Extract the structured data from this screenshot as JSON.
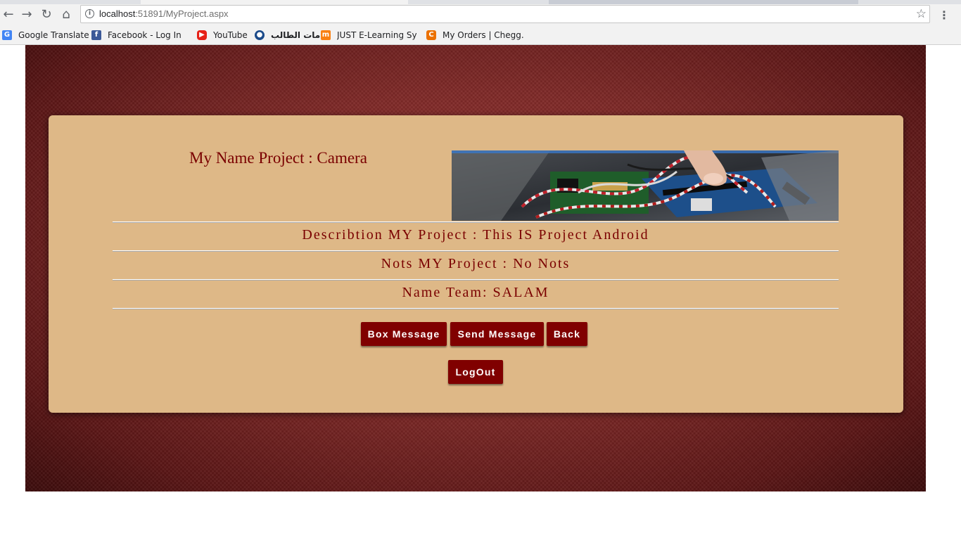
{
  "browser": {
    "url_host": "localhost",
    "url_path": ":51891/MyProject.aspx",
    "bookmarks": [
      {
        "label": "Google Translate",
        "icon": "google-translate-icon",
        "color": "#4285f4"
      },
      {
        "label": "Facebook - Log In or",
        "icon": "facebook-icon",
        "color": "#3b5998"
      },
      {
        "label": "YouTube",
        "icon": "youtube-icon",
        "color": "#e62117"
      },
      {
        "label": "خدمات الطالب",
        "icon": "university-seal-icon",
        "color": "#1a4a8a"
      },
      {
        "label": "JUST E-Learning Syste",
        "icon": "moodle-icon",
        "color": "#f98012"
      },
      {
        "label": "My Orders | Chegg.co",
        "icon": "chegg-icon",
        "color": "#eb7100"
      }
    ]
  },
  "project": {
    "title": "My Name Project : Camera",
    "description": "Describtion MY Project : This IS Project Android",
    "notes": "Nots MY Project : No Nots",
    "team": "Name Team: SALAM"
  },
  "buttons": {
    "box_message": "Box Message",
    "send_message": "Send Message",
    "back": "Back",
    "logout": "LogOut"
  },
  "colors": {
    "card": "#deb887",
    "accent_text": "#7a0000",
    "button": "#800000",
    "page_bg": "#7e2826"
  }
}
